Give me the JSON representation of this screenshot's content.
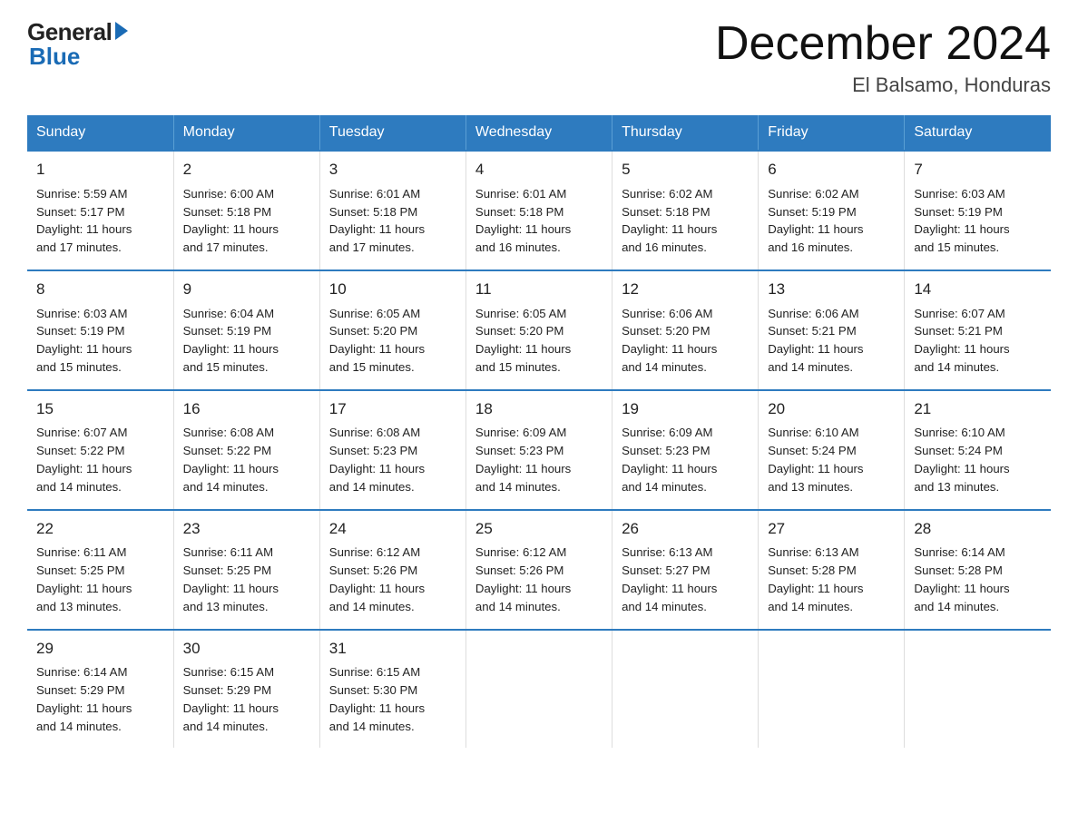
{
  "logo": {
    "general": "General",
    "blue": "Blue"
  },
  "title": "December 2024",
  "subtitle": "El Balsamo, Honduras",
  "days_of_week": [
    "Sunday",
    "Monday",
    "Tuesday",
    "Wednesday",
    "Thursday",
    "Friday",
    "Saturday"
  ],
  "weeks": [
    [
      {
        "day": "1",
        "info": "Sunrise: 5:59 AM\nSunset: 5:17 PM\nDaylight: 11 hours\nand 17 minutes."
      },
      {
        "day": "2",
        "info": "Sunrise: 6:00 AM\nSunset: 5:18 PM\nDaylight: 11 hours\nand 17 minutes."
      },
      {
        "day": "3",
        "info": "Sunrise: 6:01 AM\nSunset: 5:18 PM\nDaylight: 11 hours\nand 17 minutes."
      },
      {
        "day": "4",
        "info": "Sunrise: 6:01 AM\nSunset: 5:18 PM\nDaylight: 11 hours\nand 16 minutes."
      },
      {
        "day": "5",
        "info": "Sunrise: 6:02 AM\nSunset: 5:18 PM\nDaylight: 11 hours\nand 16 minutes."
      },
      {
        "day": "6",
        "info": "Sunrise: 6:02 AM\nSunset: 5:19 PM\nDaylight: 11 hours\nand 16 minutes."
      },
      {
        "day": "7",
        "info": "Sunrise: 6:03 AM\nSunset: 5:19 PM\nDaylight: 11 hours\nand 15 minutes."
      }
    ],
    [
      {
        "day": "8",
        "info": "Sunrise: 6:03 AM\nSunset: 5:19 PM\nDaylight: 11 hours\nand 15 minutes."
      },
      {
        "day": "9",
        "info": "Sunrise: 6:04 AM\nSunset: 5:19 PM\nDaylight: 11 hours\nand 15 minutes."
      },
      {
        "day": "10",
        "info": "Sunrise: 6:05 AM\nSunset: 5:20 PM\nDaylight: 11 hours\nand 15 minutes."
      },
      {
        "day": "11",
        "info": "Sunrise: 6:05 AM\nSunset: 5:20 PM\nDaylight: 11 hours\nand 15 minutes."
      },
      {
        "day": "12",
        "info": "Sunrise: 6:06 AM\nSunset: 5:20 PM\nDaylight: 11 hours\nand 14 minutes."
      },
      {
        "day": "13",
        "info": "Sunrise: 6:06 AM\nSunset: 5:21 PM\nDaylight: 11 hours\nand 14 minutes."
      },
      {
        "day": "14",
        "info": "Sunrise: 6:07 AM\nSunset: 5:21 PM\nDaylight: 11 hours\nand 14 minutes."
      }
    ],
    [
      {
        "day": "15",
        "info": "Sunrise: 6:07 AM\nSunset: 5:22 PM\nDaylight: 11 hours\nand 14 minutes."
      },
      {
        "day": "16",
        "info": "Sunrise: 6:08 AM\nSunset: 5:22 PM\nDaylight: 11 hours\nand 14 minutes."
      },
      {
        "day": "17",
        "info": "Sunrise: 6:08 AM\nSunset: 5:23 PM\nDaylight: 11 hours\nand 14 minutes."
      },
      {
        "day": "18",
        "info": "Sunrise: 6:09 AM\nSunset: 5:23 PM\nDaylight: 11 hours\nand 14 minutes."
      },
      {
        "day": "19",
        "info": "Sunrise: 6:09 AM\nSunset: 5:23 PM\nDaylight: 11 hours\nand 14 minutes."
      },
      {
        "day": "20",
        "info": "Sunrise: 6:10 AM\nSunset: 5:24 PM\nDaylight: 11 hours\nand 13 minutes."
      },
      {
        "day": "21",
        "info": "Sunrise: 6:10 AM\nSunset: 5:24 PM\nDaylight: 11 hours\nand 13 minutes."
      }
    ],
    [
      {
        "day": "22",
        "info": "Sunrise: 6:11 AM\nSunset: 5:25 PM\nDaylight: 11 hours\nand 13 minutes."
      },
      {
        "day": "23",
        "info": "Sunrise: 6:11 AM\nSunset: 5:25 PM\nDaylight: 11 hours\nand 13 minutes."
      },
      {
        "day": "24",
        "info": "Sunrise: 6:12 AM\nSunset: 5:26 PM\nDaylight: 11 hours\nand 14 minutes."
      },
      {
        "day": "25",
        "info": "Sunrise: 6:12 AM\nSunset: 5:26 PM\nDaylight: 11 hours\nand 14 minutes."
      },
      {
        "day": "26",
        "info": "Sunrise: 6:13 AM\nSunset: 5:27 PM\nDaylight: 11 hours\nand 14 minutes."
      },
      {
        "day": "27",
        "info": "Sunrise: 6:13 AM\nSunset: 5:28 PM\nDaylight: 11 hours\nand 14 minutes."
      },
      {
        "day": "28",
        "info": "Sunrise: 6:14 AM\nSunset: 5:28 PM\nDaylight: 11 hours\nand 14 minutes."
      }
    ],
    [
      {
        "day": "29",
        "info": "Sunrise: 6:14 AM\nSunset: 5:29 PM\nDaylight: 11 hours\nand 14 minutes."
      },
      {
        "day": "30",
        "info": "Sunrise: 6:15 AM\nSunset: 5:29 PM\nDaylight: 11 hours\nand 14 minutes."
      },
      {
        "day": "31",
        "info": "Sunrise: 6:15 AM\nSunset: 5:30 PM\nDaylight: 11 hours\nand 14 minutes."
      },
      {
        "day": "",
        "info": ""
      },
      {
        "day": "",
        "info": ""
      },
      {
        "day": "",
        "info": ""
      },
      {
        "day": "",
        "info": ""
      }
    ]
  ]
}
